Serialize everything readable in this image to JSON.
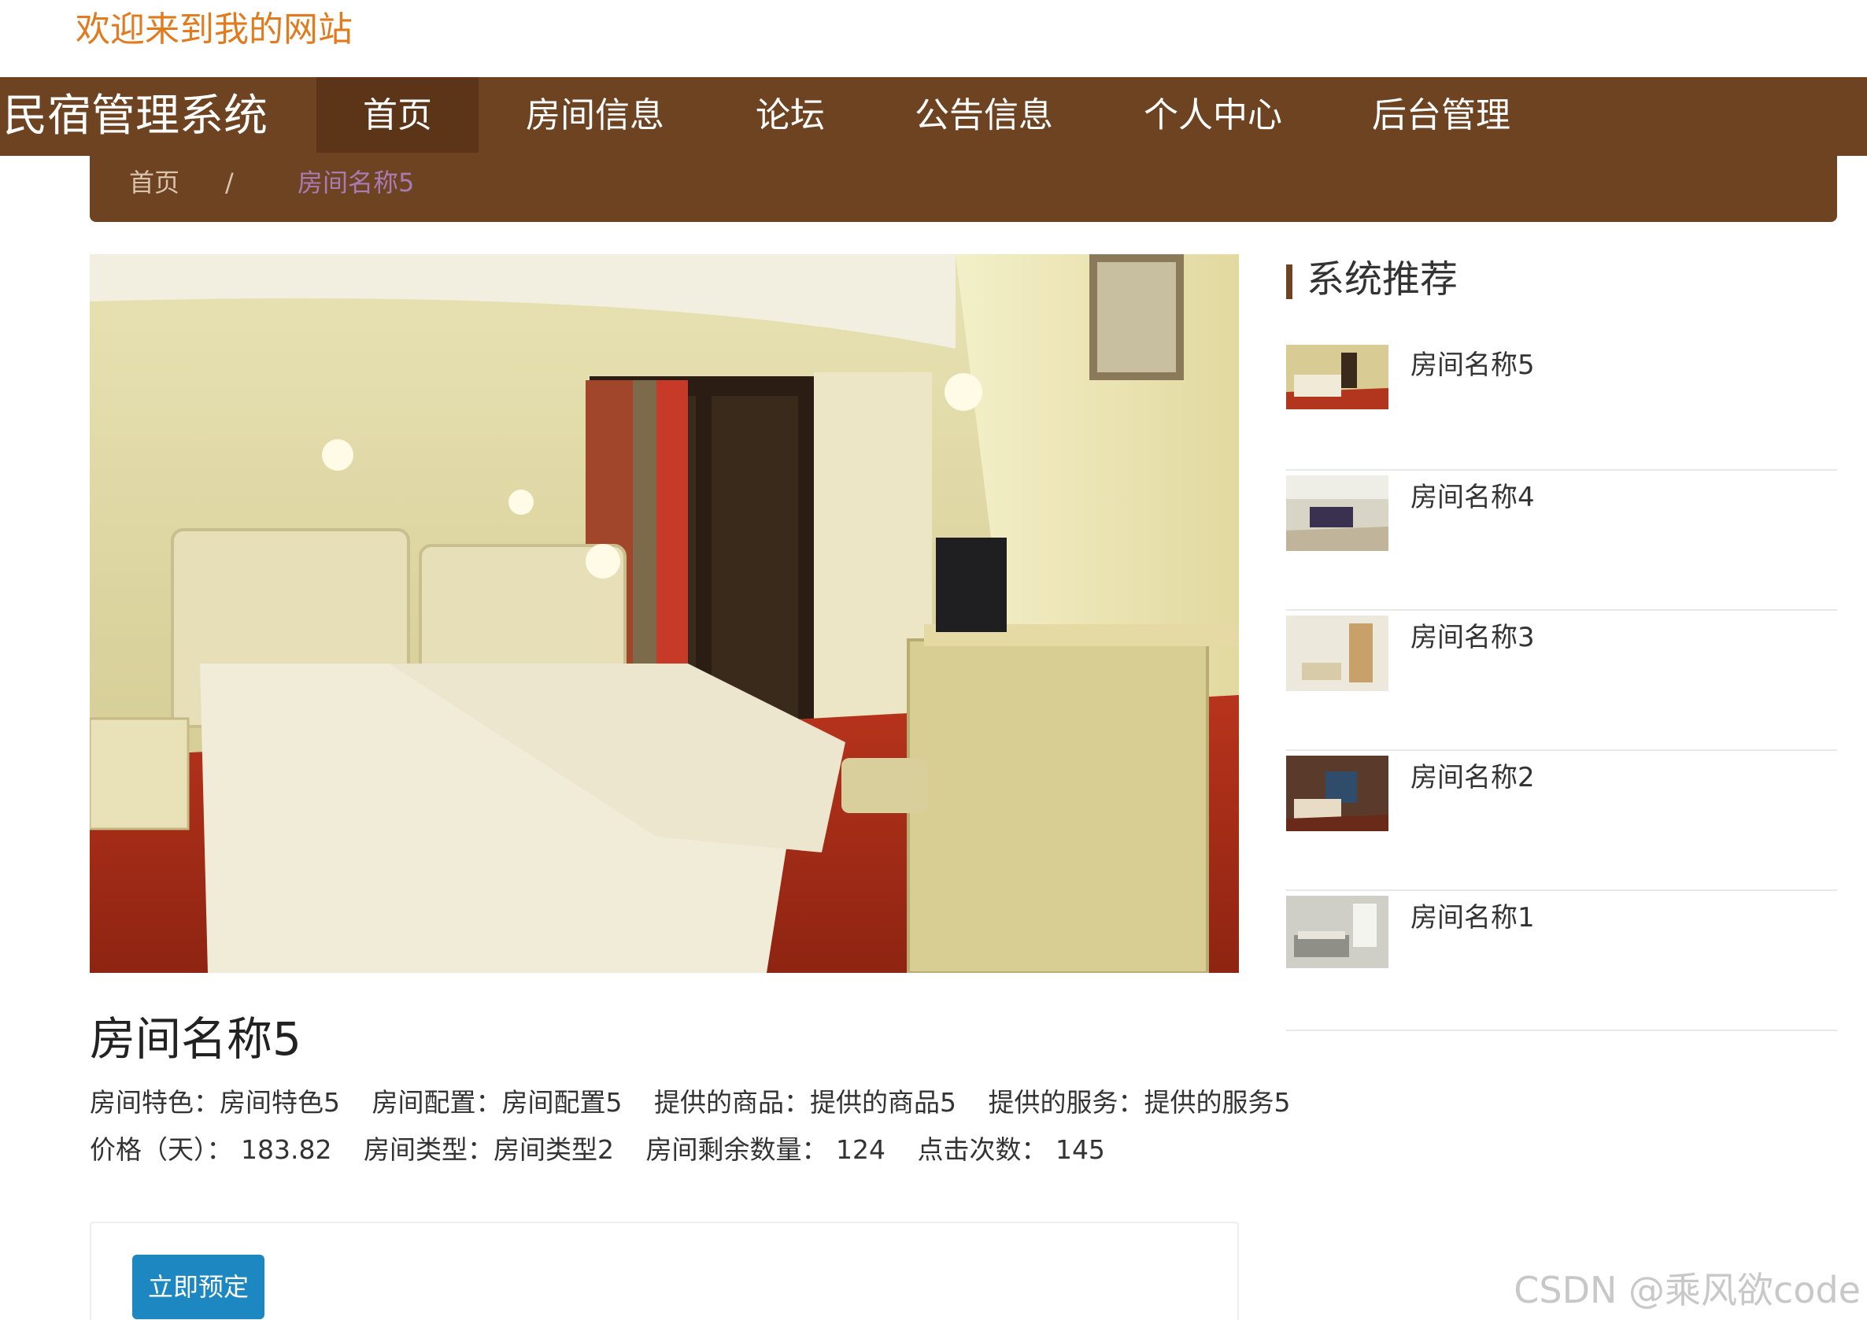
{
  "header": {
    "welcome_text": "欢迎来到我的网站"
  },
  "navbar": {
    "brand": "民宿管理系统",
    "items": [
      {
        "label": "首页",
        "active": true
      },
      {
        "label": "房间信息"
      },
      {
        "label": "论坛"
      },
      {
        "label": "公告信息"
      },
      {
        "label": "个人中心"
      },
      {
        "label": "后台管理"
      }
    ]
  },
  "breadcrumb": {
    "home": "首页",
    "separator": "/",
    "current": "房间名称5"
  },
  "room": {
    "image_icon": "room-photo",
    "title": "房间名称5",
    "details_line1": [
      "房间特色：房间特色5",
      "房间配置：房间配置5",
      "提供的商品：提供的商品5",
      "提供的服务：提供的服务5"
    ],
    "details_line2": [
      "价格（天）： 183.82",
      "房间类型：房间类型2",
      "房间剩余数量： 124",
      "点击次数： 145"
    ],
    "book_button": "立即预定"
  },
  "sidebar": {
    "title": "系统推荐",
    "items": [
      {
        "name": "房间名称5"
      },
      {
        "name": "房间名称4"
      },
      {
        "name": "房间名称3"
      },
      {
        "name": "房间名称2"
      },
      {
        "name": "房间名称1"
      }
    ]
  },
  "watermark": "CSDN @乘风欲code",
  "colors": {
    "brand_brown": "#6e4322",
    "welcome_orange": "#e07b1f",
    "button_blue": "#1c87c0",
    "crumb_current": "#a87bb3"
  }
}
